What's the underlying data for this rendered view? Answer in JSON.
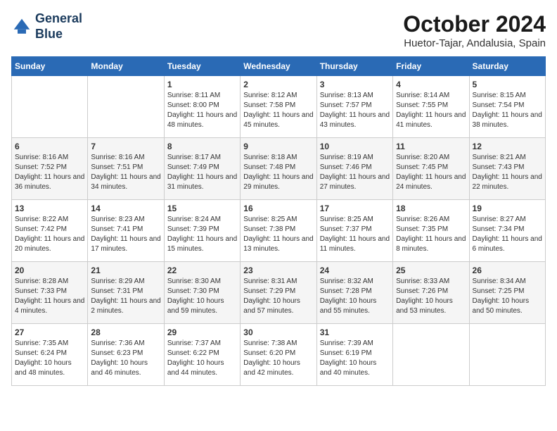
{
  "header": {
    "logo_line1": "General",
    "logo_line2": "Blue",
    "month_title": "October 2024",
    "location": "Huetor-Tajar, Andalusia, Spain"
  },
  "columns": [
    "Sunday",
    "Monday",
    "Tuesday",
    "Wednesday",
    "Thursday",
    "Friday",
    "Saturday"
  ],
  "weeks": [
    [
      {
        "day": "",
        "content": ""
      },
      {
        "day": "",
        "content": ""
      },
      {
        "day": "1",
        "content": "Sunrise: 8:11 AM\nSunset: 8:00 PM\nDaylight: 11 hours and 48 minutes."
      },
      {
        "day": "2",
        "content": "Sunrise: 8:12 AM\nSunset: 7:58 PM\nDaylight: 11 hours and 45 minutes."
      },
      {
        "day": "3",
        "content": "Sunrise: 8:13 AM\nSunset: 7:57 PM\nDaylight: 11 hours and 43 minutes."
      },
      {
        "day": "4",
        "content": "Sunrise: 8:14 AM\nSunset: 7:55 PM\nDaylight: 11 hours and 41 minutes."
      },
      {
        "day": "5",
        "content": "Sunrise: 8:15 AM\nSunset: 7:54 PM\nDaylight: 11 hours and 38 minutes."
      }
    ],
    [
      {
        "day": "6",
        "content": "Sunrise: 8:16 AM\nSunset: 7:52 PM\nDaylight: 11 hours and 36 minutes."
      },
      {
        "day": "7",
        "content": "Sunrise: 8:16 AM\nSunset: 7:51 PM\nDaylight: 11 hours and 34 minutes."
      },
      {
        "day": "8",
        "content": "Sunrise: 8:17 AM\nSunset: 7:49 PM\nDaylight: 11 hours and 31 minutes."
      },
      {
        "day": "9",
        "content": "Sunrise: 8:18 AM\nSunset: 7:48 PM\nDaylight: 11 hours and 29 minutes."
      },
      {
        "day": "10",
        "content": "Sunrise: 8:19 AM\nSunset: 7:46 PM\nDaylight: 11 hours and 27 minutes."
      },
      {
        "day": "11",
        "content": "Sunrise: 8:20 AM\nSunset: 7:45 PM\nDaylight: 11 hours and 24 minutes."
      },
      {
        "day": "12",
        "content": "Sunrise: 8:21 AM\nSunset: 7:43 PM\nDaylight: 11 hours and 22 minutes."
      }
    ],
    [
      {
        "day": "13",
        "content": "Sunrise: 8:22 AM\nSunset: 7:42 PM\nDaylight: 11 hours and 20 minutes."
      },
      {
        "day": "14",
        "content": "Sunrise: 8:23 AM\nSunset: 7:41 PM\nDaylight: 11 hours and 17 minutes."
      },
      {
        "day": "15",
        "content": "Sunrise: 8:24 AM\nSunset: 7:39 PM\nDaylight: 11 hours and 15 minutes."
      },
      {
        "day": "16",
        "content": "Sunrise: 8:25 AM\nSunset: 7:38 PM\nDaylight: 11 hours and 13 minutes."
      },
      {
        "day": "17",
        "content": "Sunrise: 8:25 AM\nSunset: 7:37 PM\nDaylight: 11 hours and 11 minutes."
      },
      {
        "day": "18",
        "content": "Sunrise: 8:26 AM\nSunset: 7:35 PM\nDaylight: 11 hours and 8 minutes."
      },
      {
        "day": "19",
        "content": "Sunrise: 8:27 AM\nSunset: 7:34 PM\nDaylight: 11 hours and 6 minutes."
      }
    ],
    [
      {
        "day": "20",
        "content": "Sunrise: 8:28 AM\nSunset: 7:33 PM\nDaylight: 11 hours and 4 minutes."
      },
      {
        "day": "21",
        "content": "Sunrise: 8:29 AM\nSunset: 7:31 PM\nDaylight: 11 hours and 2 minutes."
      },
      {
        "day": "22",
        "content": "Sunrise: 8:30 AM\nSunset: 7:30 PM\nDaylight: 10 hours and 59 minutes."
      },
      {
        "day": "23",
        "content": "Sunrise: 8:31 AM\nSunset: 7:29 PM\nDaylight: 10 hours and 57 minutes."
      },
      {
        "day": "24",
        "content": "Sunrise: 8:32 AM\nSunset: 7:28 PM\nDaylight: 10 hours and 55 minutes."
      },
      {
        "day": "25",
        "content": "Sunrise: 8:33 AM\nSunset: 7:26 PM\nDaylight: 10 hours and 53 minutes."
      },
      {
        "day": "26",
        "content": "Sunrise: 8:34 AM\nSunset: 7:25 PM\nDaylight: 10 hours and 50 minutes."
      }
    ],
    [
      {
        "day": "27",
        "content": "Sunrise: 7:35 AM\nSunset: 6:24 PM\nDaylight: 10 hours and 48 minutes."
      },
      {
        "day": "28",
        "content": "Sunrise: 7:36 AM\nSunset: 6:23 PM\nDaylight: 10 hours and 46 minutes."
      },
      {
        "day": "29",
        "content": "Sunrise: 7:37 AM\nSunset: 6:22 PM\nDaylight: 10 hours and 44 minutes."
      },
      {
        "day": "30",
        "content": "Sunrise: 7:38 AM\nSunset: 6:20 PM\nDaylight: 10 hours and 42 minutes."
      },
      {
        "day": "31",
        "content": "Sunrise: 7:39 AM\nSunset: 6:19 PM\nDaylight: 10 hours and 40 minutes."
      },
      {
        "day": "",
        "content": ""
      },
      {
        "day": "",
        "content": ""
      }
    ]
  ]
}
